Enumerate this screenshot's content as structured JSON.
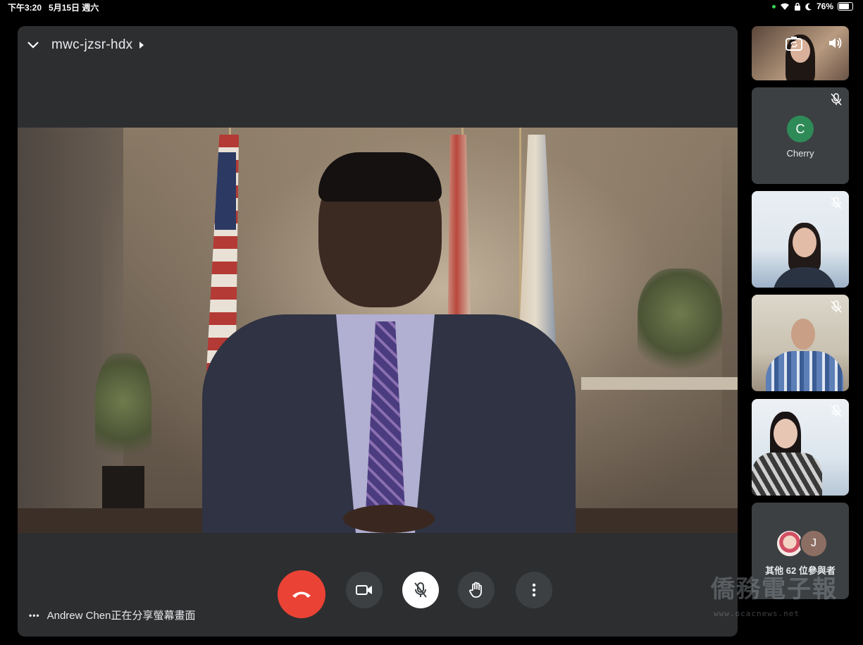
{
  "status_bar": {
    "time": "下午3:20",
    "date": "5月15日 週六",
    "battery": "76%",
    "battery_level": 0.76
  },
  "meeting": {
    "code": "mwc-jzsr-hdx"
  },
  "presenting": {
    "text": "Andrew Chen正在分享螢幕畫面"
  },
  "participants": {
    "cherry": {
      "initial": "C",
      "name": "Cherry"
    },
    "others": {
      "avatar_initial": "J",
      "label": "其他 62 位參與者"
    }
  },
  "watermark": {
    "text": "僑務電子報",
    "url": "www.ocacnews.net"
  },
  "icons": {
    "collapse": "chevron-down-icon",
    "info": "caret-right-icon",
    "end_call": "phone-hangup-icon",
    "camera": "video-camera-icon",
    "mic": "mic-off-icon",
    "raise_hand": "hand-icon",
    "more": "more-vert-icon",
    "switch_camera": "switch-camera-icon",
    "speaker": "speaker-icon"
  },
  "colors": {
    "end_call": "#ea4335",
    "stage_bg": "#2d2e30",
    "button_bg": "#3c4043",
    "cherry_avatar": "#2e8b57"
  }
}
